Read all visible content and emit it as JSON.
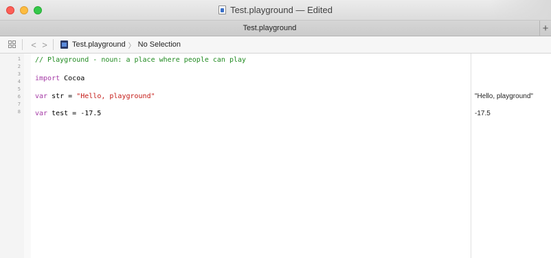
{
  "window": {
    "title": "Test.playground — Edited"
  },
  "tabbar": {
    "tab_label": "Test.playground",
    "add_label": "+"
  },
  "jumpbar": {
    "back_label": "<",
    "forward_label": ">",
    "file": "Test.playground",
    "separator": "〉",
    "selection": "No Selection"
  },
  "gutter": {
    "line_numbers": [
      "1",
      "2",
      "3",
      "4",
      "5",
      "6",
      "7",
      "8"
    ]
  },
  "code": {
    "line1": "// Playground - noun: a place where people can play",
    "line3_kw": "import",
    "line3_rest": " Cocoa",
    "line5_kw": "var",
    "line5_mid": " str = ",
    "line5_str": "\"Hello, playground\"",
    "line7_kw": "var",
    "line7_rest": " test = -17.5"
  },
  "results": {
    "str_result": "\"Hello, playground\"",
    "test_result": "-17.5"
  },
  "colors": {
    "comment": "#1f8a1f",
    "keyword": "#a53aa6",
    "string": "#c41a16"
  },
  "icons": [
    "close-button",
    "minimize-button",
    "zoom-button",
    "playground-doc-icon",
    "grid-icon",
    "back-arrow-icon",
    "forward-arrow-icon",
    "playground-file-icon"
  ]
}
